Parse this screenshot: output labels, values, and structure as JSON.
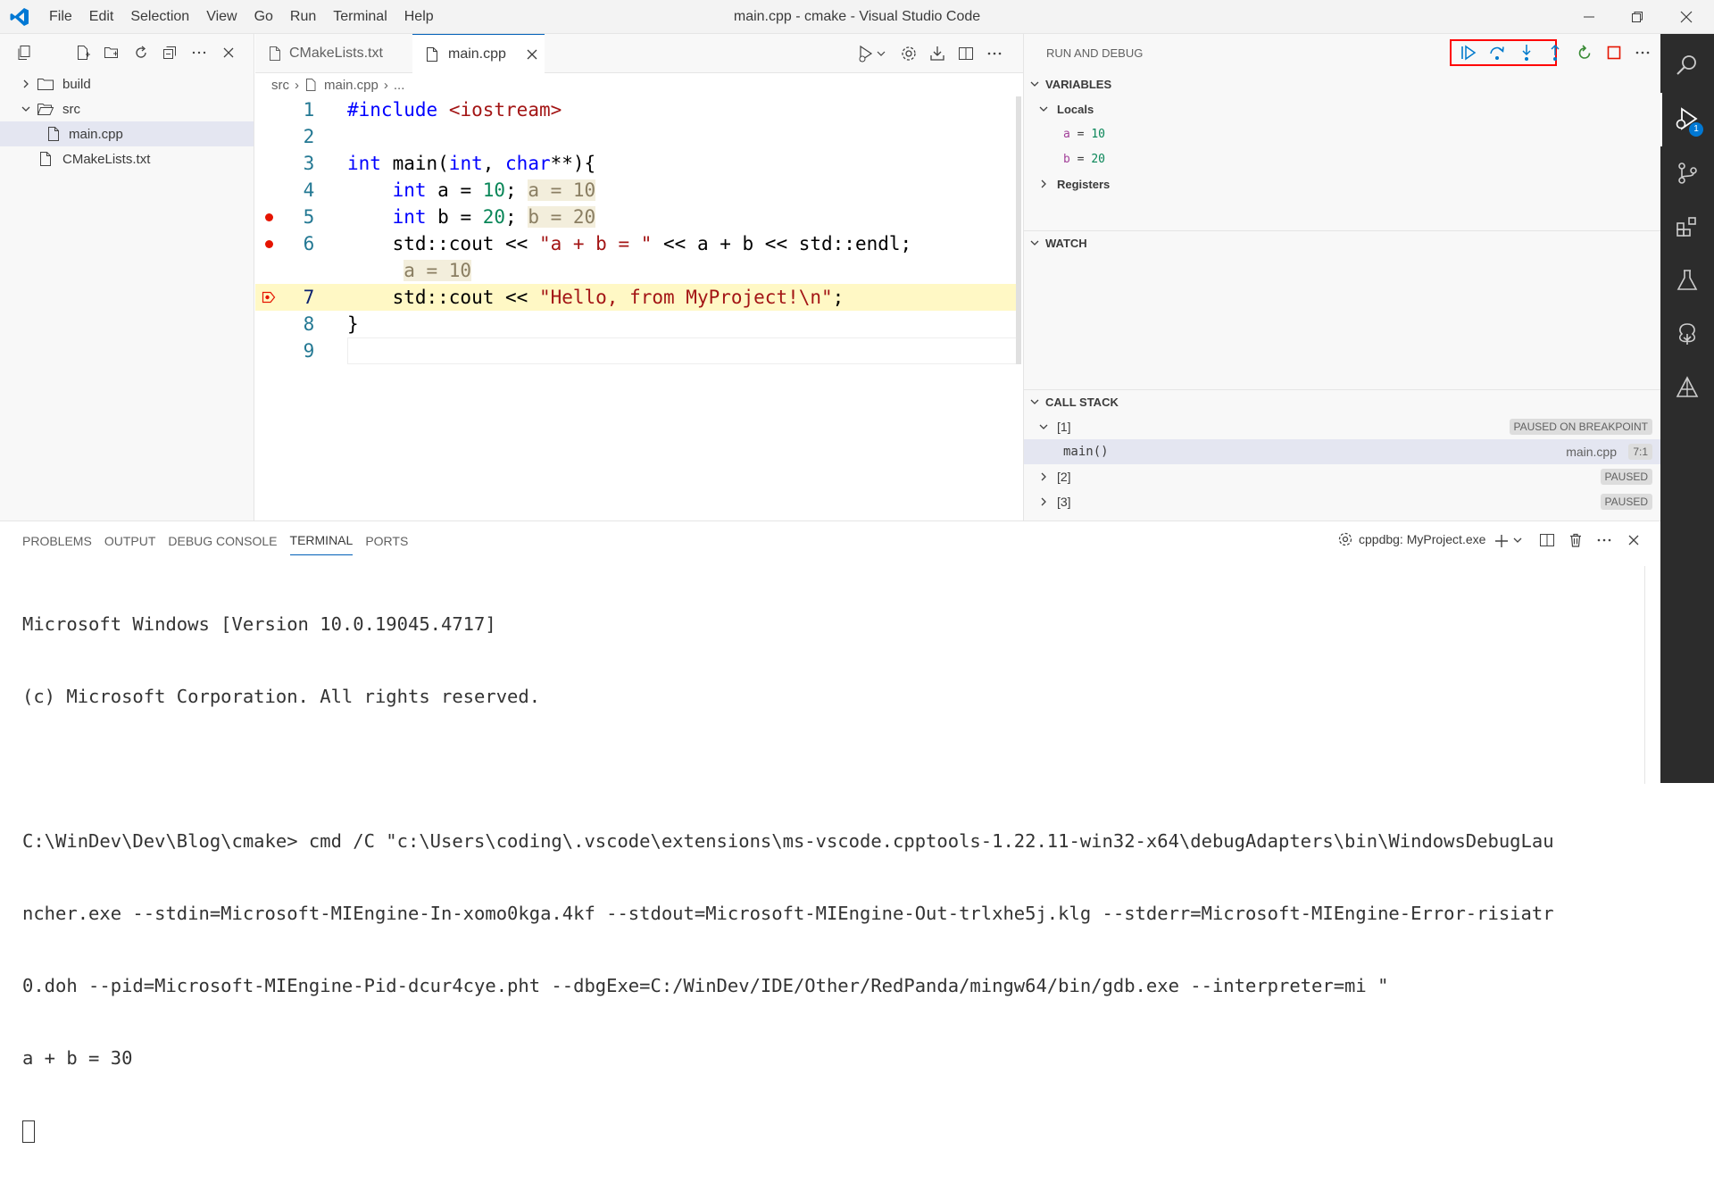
{
  "menu": [
    "File",
    "Edit",
    "Selection",
    "View",
    "Go",
    "Run",
    "Terminal",
    "Help"
  ],
  "window_title": "main.cpp - cmake - Visual Studio Code",
  "explorer": {
    "tree": [
      {
        "label": "build",
        "type": "folder",
        "expanded": false,
        "depth": 0
      },
      {
        "label": "src",
        "type": "folder",
        "expanded": true,
        "depth": 0
      },
      {
        "label": "main.cpp",
        "type": "file",
        "depth": 1,
        "selected": true
      },
      {
        "label": "CMakeLists.txt",
        "type": "file",
        "depth": 0
      }
    ]
  },
  "tabs": [
    {
      "label": "CMakeLists.txt",
      "active": false
    },
    {
      "label": "main.cpp",
      "active": true
    }
  ],
  "breadcrumb": {
    "folder": "src",
    "file": "main.cpp",
    "rest": "..."
  },
  "code": {
    "line_numbers": [
      "1",
      "2",
      "3",
      "4",
      "5",
      "6",
      "7",
      "8",
      "9"
    ],
    "inline_values": {
      "l4": "a = 10",
      "l5": "b = 20",
      "l6": "a = 10"
    },
    "current_line": 7
  },
  "run_and_debug": {
    "title": "RUN AND DEBUG",
    "variables_title": "VARIABLES",
    "locals_label": "Locals",
    "locals": [
      {
        "name": "a",
        "value": "10"
      },
      {
        "name": "b",
        "value": "20"
      }
    ],
    "registers_label": "Registers",
    "watch_title": "WATCH",
    "callstack_title": "CALL STACK",
    "threads": [
      {
        "label": "[1]",
        "status": "PAUSED ON BREAKPOINT",
        "expanded": true
      },
      {
        "label": "[2]",
        "status": "PAUSED",
        "expanded": false
      },
      {
        "label": "[3]",
        "status": "PAUSED",
        "expanded": false
      }
    ],
    "frame": {
      "name": "main()",
      "file": "main.cpp",
      "pos": "7:1"
    }
  },
  "activity": {
    "debug_badge": "1"
  },
  "panel": {
    "tabs": [
      "PROBLEMS",
      "OUTPUT",
      "DEBUG CONSOLE",
      "TERMINAL",
      "PORTS"
    ],
    "active_tab": "TERMINAL",
    "terminal_name": "cppdbg: MyProject.exe",
    "lines": [
      "Microsoft Windows [Version 10.0.19045.4717]",
      "(c) Microsoft Corporation. All rights reserved.",
      "",
      "C:\\WinDev\\Dev\\Blog\\cmake> cmd /C \"c:\\Users\\coding\\.vscode\\extensions\\ms-vscode.cpptools-1.22.11-win32-x64\\debugAdapters\\bin\\WindowsDebugLau",
      "ncher.exe --stdin=Microsoft-MIEngine-In-xomo0kga.4kf --stdout=Microsoft-MIEngine-Out-trlxhe5j.klg --stderr=Microsoft-MIEngine-Error-risiatr",
      "0.doh --pid=Microsoft-MIEngine-Pid-dcur4cye.pht --dbgExe=C:/WinDev/IDE/Other/RedPanda/mingw64/bin/gdb.exe --interpreter=mi \"",
      "a + b = 30"
    ]
  },
  "colors": {
    "accent": "#005fb8",
    "breakpoint": "#e51400",
    "debug_blue": "#007acc",
    "highlight": "#ff0000"
  }
}
